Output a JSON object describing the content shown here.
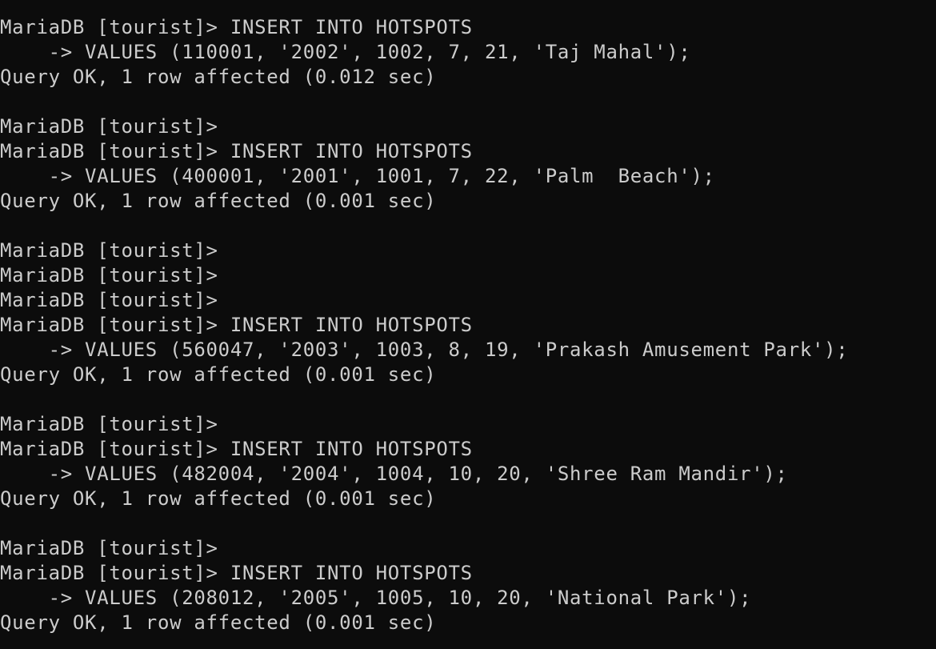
{
  "terminal": {
    "lines": [
      "MariaDB [tourist]> INSERT INTO HOTSPOTS",
      "    -> VALUES (110001, '2002', 1002, 7, 21, 'Taj Mahal');",
      "Query OK, 1 row affected (0.012 sec)",
      "",
      "MariaDB [tourist]>",
      "MariaDB [tourist]> INSERT INTO HOTSPOTS",
      "    -> VALUES (400001, '2001', 1001, 7, 22, 'Palm  Beach');",
      "Query OK, 1 row affected (0.001 sec)",
      "",
      "MariaDB [tourist]>",
      "MariaDB [tourist]>",
      "MariaDB [tourist]>",
      "MariaDB [tourist]> INSERT INTO HOTSPOTS",
      "    -> VALUES (560047, '2003', 1003, 8, 19, 'Prakash Amusement Park');",
      "Query OK, 1 row affected (0.001 sec)",
      "",
      "MariaDB [tourist]>",
      "MariaDB [tourist]> INSERT INTO HOTSPOTS",
      "    -> VALUES (482004, '2004', 1004, 10, 20, 'Shree Ram Mandir');",
      "Query OK, 1 row affected (0.001 sec)",
      "",
      "MariaDB [tourist]>",
      "MariaDB [tourist]> INSERT INTO HOTSPOTS",
      "    -> VALUES (208012, '2005', 1005, 10, 20, 'National Park');",
      "Query OK, 1 row affected (0.001 sec)"
    ]
  },
  "colors": {
    "background": "#0c0c0c",
    "text": "#cccccc"
  }
}
